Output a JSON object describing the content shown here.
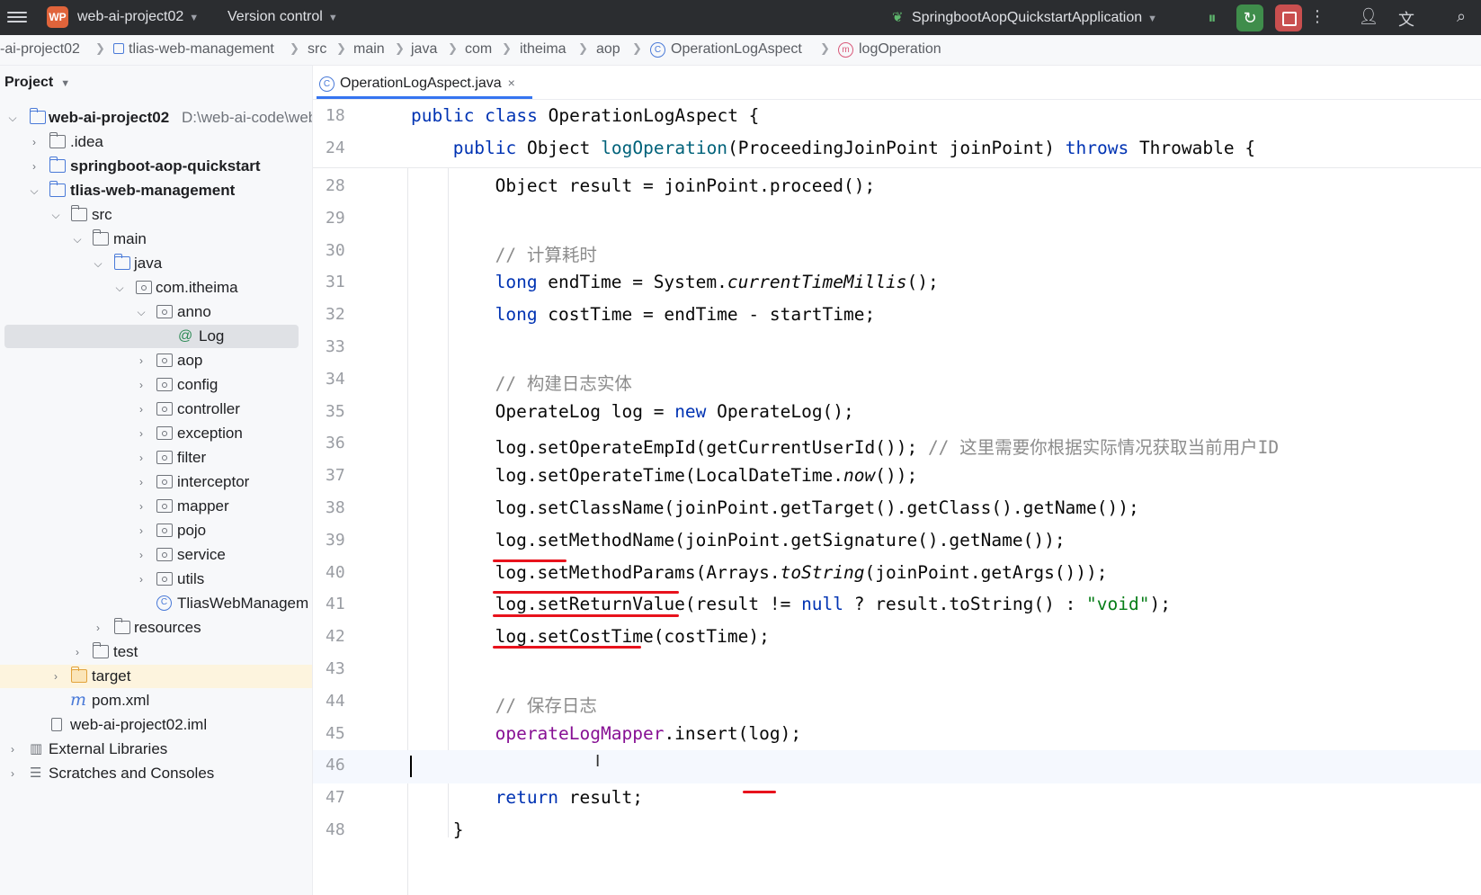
{
  "titlebar": {
    "project_badge": "WP",
    "project_name": "web-ai-project02",
    "version_control": "Version control",
    "run_config": "SpringbootAopQuickstartApplication",
    "caret": "⌵"
  },
  "breadcrumb": [
    "-ai-project02",
    "tlias-web-management",
    "src",
    "main",
    "java",
    "com",
    "itheima",
    "aop",
    "OperationLogAspect",
    "logOperation"
  ],
  "project_panel": {
    "title": "Project",
    "tree": [
      {
        "label": "web-ai-project02",
        "path": "D:\\web-ai-code\\web",
        "bold": true
      },
      {
        "label": ".idea"
      },
      {
        "label": "springboot-aop-quickstart",
        "bold": true
      },
      {
        "label": "tlias-web-management",
        "bold": true
      },
      {
        "label": "src"
      },
      {
        "label": "main"
      },
      {
        "label": "java"
      },
      {
        "label": "com.itheima"
      },
      {
        "label": "anno"
      },
      {
        "label": "Log"
      },
      {
        "label": "aop"
      },
      {
        "label": "config"
      },
      {
        "label": "controller"
      },
      {
        "label": "exception"
      },
      {
        "label": "filter"
      },
      {
        "label": "interceptor"
      },
      {
        "label": "mapper"
      },
      {
        "label": "pojo"
      },
      {
        "label": "service"
      },
      {
        "label": "utils"
      },
      {
        "label": "TliasWebManagem"
      },
      {
        "label": "resources"
      },
      {
        "label": "test"
      },
      {
        "label": "target"
      },
      {
        "label": "pom.xml"
      },
      {
        "label": "web-ai-project02.iml"
      },
      {
        "label": "External Libraries"
      },
      {
        "label": "Scratches and Consoles"
      }
    ]
  },
  "editor": {
    "tab_label": "OperationLogAspect.java",
    "tab_close": "×",
    "sticky": [
      {
        "num": "18",
        "code": [
          [
            "kw",
            "public class "
          ],
          [
            "",
            "OperationLogAspect {"
          ]
        ]
      },
      {
        "num": "24",
        "code": [
          [
            "kw",
            "public "
          ],
          [
            "",
            "Object "
          ],
          [
            "mth",
            "logOperation"
          ],
          [
            "",
            "(ProceedingJoinPoint joinPoint) "
          ],
          [
            "kw",
            "throws "
          ],
          [
            "",
            "Throwable {"
          ]
        ]
      }
    ],
    "lines": [
      {
        "num": "28",
        "code": [
          [
            "",
            "Object result = joinPoint.proceed();"
          ]
        ]
      },
      {
        "num": "29",
        "code": []
      },
      {
        "num": "30",
        "code": [
          [
            "cm",
            "// 计算耗时"
          ]
        ]
      },
      {
        "num": "31",
        "code": [
          [
            "kw",
            "long "
          ],
          [
            "",
            "endTime = System."
          ],
          [
            "it",
            "currentTimeMillis"
          ],
          [
            "",
            "();"
          ]
        ]
      },
      {
        "num": "32",
        "code": [
          [
            "kw",
            "long "
          ],
          [
            "",
            "costTime = endTime - startTime;"
          ]
        ]
      },
      {
        "num": "33",
        "code": []
      },
      {
        "num": "34",
        "code": [
          [
            "cm",
            "// 构建日志实体"
          ]
        ]
      },
      {
        "num": "35",
        "code": [
          [
            "",
            "OperateLog log = "
          ],
          [
            "kw",
            "new "
          ],
          [
            "",
            "OperateLog();"
          ]
        ]
      },
      {
        "num": "36",
        "code": [
          [
            "",
            "log.setOperateEmpId(getCurrentUserId()); "
          ],
          [
            "cm",
            "// 这里需要你根据实际情况获取当前用户ID"
          ]
        ]
      },
      {
        "num": "37",
        "code": [
          [
            "",
            "log.setOperateTime(LocalDateTime."
          ],
          [
            "it",
            "now"
          ],
          [
            "",
            "());"
          ]
        ]
      },
      {
        "num": "38",
        "code": [
          [
            "",
            "log.setClassName(joinPoint.getTarget().getClass().getName());"
          ]
        ]
      },
      {
        "num": "39",
        "code": [
          [
            "",
            "log.setMethodName(joinPoint.getSignature().getName());"
          ]
        ]
      },
      {
        "num": "40",
        "code": [
          [
            "",
            "log.setMethodParams(Arrays."
          ],
          [
            "it",
            "toString"
          ],
          [
            "",
            "(joinPoint.getArgs()));"
          ]
        ]
      },
      {
        "num": "41",
        "code": [
          [
            "",
            "log.setReturnValue(result != "
          ],
          [
            "kw",
            "null "
          ],
          [
            "",
            "? result.toString() : "
          ],
          [
            "str",
            "\"void\""
          ],
          [
            "",
            ");"
          ]
        ]
      },
      {
        "num": "42",
        "code": [
          [
            "",
            "log.setCostTime(costTime);"
          ]
        ]
      },
      {
        "num": "43",
        "code": []
      },
      {
        "num": "44",
        "code": [
          [
            "cm",
            "// 保存日志"
          ]
        ]
      },
      {
        "num": "45",
        "code": [
          [
            "fld",
            "operateLogMapper"
          ],
          [
            "",
            ".insert(log);"
          ]
        ]
      },
      {
        "num": "46",
        "code": []
      },
      {
        "num": "47",
        "code": [
          [
            "kw",
            "return "
          ],
          [
            "",
            "result;"
          ]
        ]
      },
      {
        "num": "48",
        "code": [
          [
            "",
            "}"
          ]
        ]
      }
    ]
  }
}
